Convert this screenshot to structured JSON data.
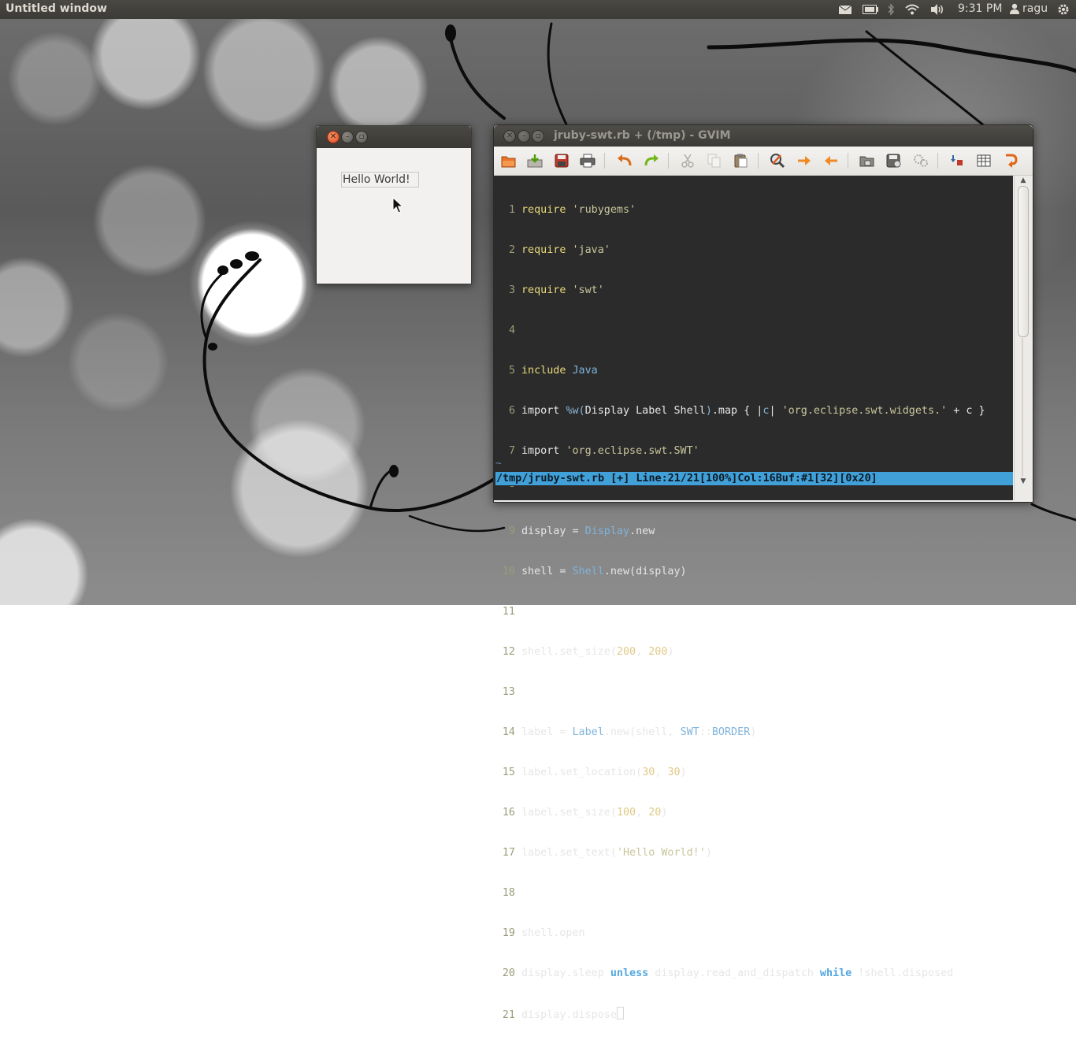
{
  "panel": {
    "app_title": "Untitled window",
    "clock": "9:31 PM",
    "user": "ragu",
    "indicators": [
      "mail-icon",
      "battery-icon",
      "bluetooth-icon",
      "wifi-icon",
      "volume-icon"
    ],
    "session_icon": "gear-icon"
  },
  "swt_window": {
    "label_text": "Hello World!"
  },
  "gvim": {
    "title": "jruby-swt.rb + (/tmp) - GVIM",
    "toolbar": [
      "open-icon",
      "save-icon",
      "save-all-icon",
      "print-icon",
      "undo-icon",
      "redo-icon",
      "cut-icon",
      "copy-icon",
      "paste-icon",
      "find-replace-icon",
      "find-next-icon",
      "find-prev-icon",
      "load-session-icon",
      "save-session-icon",
      "run-script-icon",
      "make-icon",
      "tags-icon",
      "jump-icon"
    ],
    "code_lines": [
      "require 'rubygems'",
      "require 'java'",
      "require 'swt'",
      "",
      "include Java",
      "import %w(Display Label Shell).map { |c| 'org.eclipse.swt.widgets.' + c }",
      "import 'org.eclipse.swt.SWT'",
      "",
      "display = Display.new",
      "shell = Shell.new(display)",
      "",
      "shell.set_size(200, 200)",
      "",
      "label = Label.new(shell, SWT::BORDER)",
      "label.set_location(30, 30)",
      "label.set_size(100, 20)",
      "label.set_text('Hello World!')",
      "",
      "shell.open",
      "display.sleep unless display.read_and_dispatch while !shell.disposed",
      "display.dispose"
    ],
    "tilde": "~",
    "statusline": "/tmp/jruby-swt.rb [+] Line:21/21[100%]Col:16Buf:#1[32][0x20]",
    "colors": {
      "background": "#2b2b2b",
      "statusline": "#41a0d8",
      "keyword": "#e8d97a",
      "constant": "#7fb4dc"
    }
  }
}
